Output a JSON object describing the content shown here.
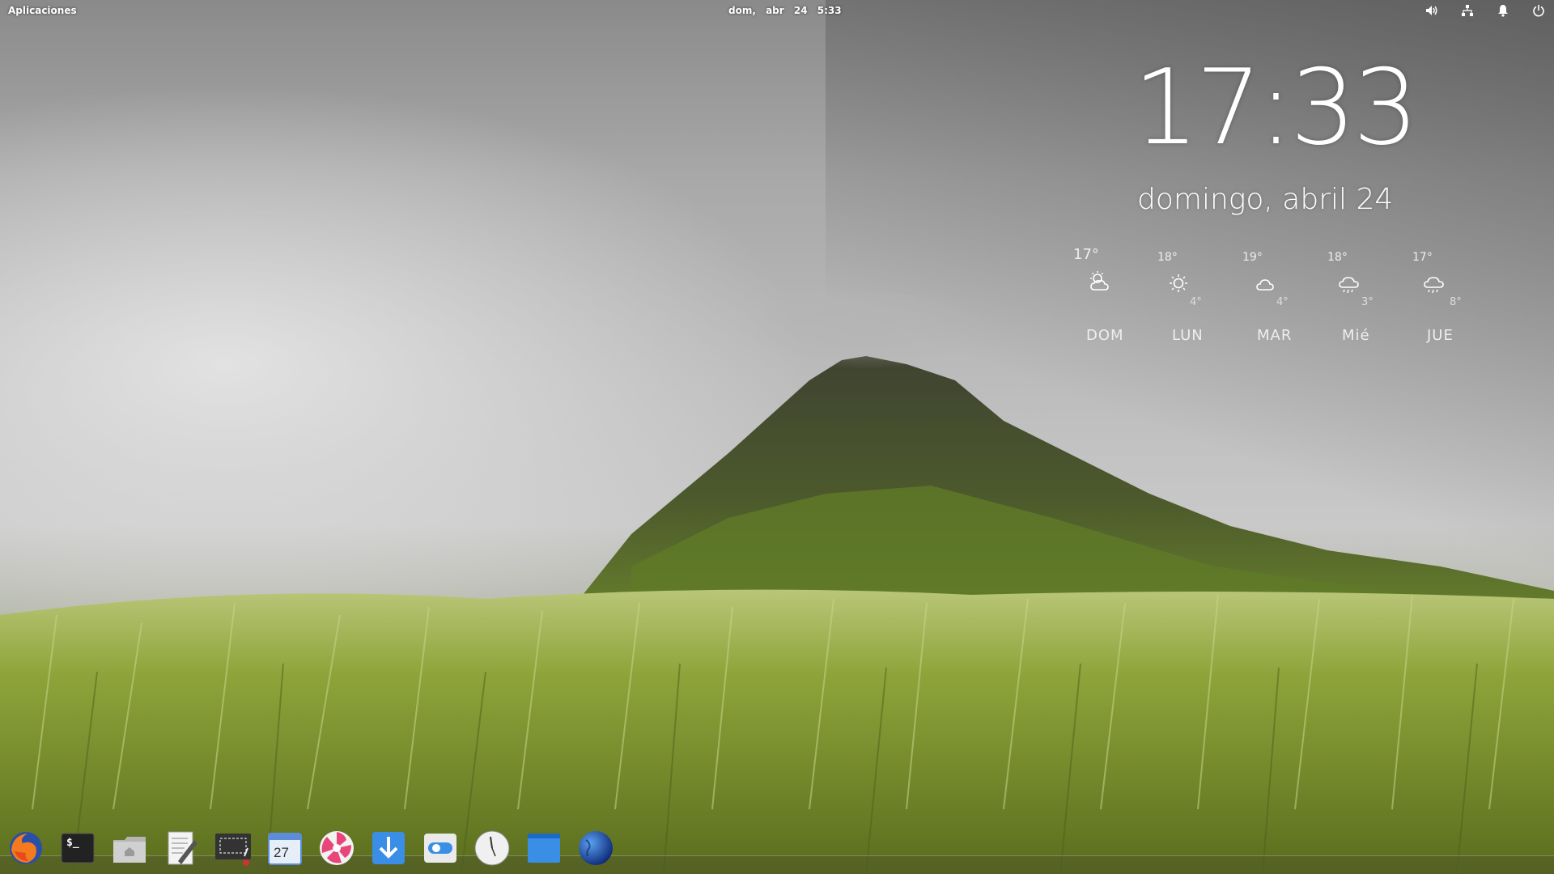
{
  "panel": {
    "apps_label": "Aplicaciones",
    "date": "dom, abr 24",
    "time": "5:33",
    "indicators": [
      "volume-icon",
      "network-icon",
      "notifications-icon",
      "power-icon"
    ]
  },
  "clock_widget": {
    "time": "17:33",
    "date": "domingo, abril 24"
  },
  "forecast": [
    {
      "day": "DOM",
      "high": "17°",
      "low": "",
      "icon": "partly-cloudy-icon"
    },
    {
      "day": "LUN",
      "high": "18°",
      "low": "4°",
      "icon": "sun-icon"
    },
    {
      "day": "MAR",
      "high": "19°",
      "low": "4°",
      "icon": "cloud-icon"
    },
    {
      "day": "Mié",
      "high": "18°",
      "low": "3°",
      "icon": "rain-icon"
    },
    {
      "day": "JUE",
      "high": "17°",
      "low": "8°",
      "icon": "rain-icon"
    }
  ],
  "dock": {
    "items": [
      {
        "name": "firefox",
        "icon": "firefox-icon"
      },
      {
        "name": "terminal",
        "icon": "terminal-icon",
        "label": "$_"
      },
      {
        "name": "files",
        "icon": "home-folder-icon"
      },
      {
        "name": "text-editor",
        "icon": "text-editor-icon"
      },
      {
        "name": "screenshot",
        "icon": "screenshot-icon"
      },
      {
        "name": "calendar",
        "icon": "calendar-icon",
        "label": "27"
      },
      {
        "name": "music",
        "icon": "music-icon"
      },
      {
        "name": "software-center",
        "icon": "download-icon"
      },
      {
        "name": "settings",
        "icon": "toggle-icon"
      },
      {
        "name": "clock",
        "icon": "clock-icon"
      },
      {
        "name": "multitasking",
        "icon": "window-icon"
      },
      {
        "name": "web-browser",
        "icon": "globe-icon"
      }
    ]
  },
  "colors": {
    "panel_text": "#ffffff",
    "dock_shelf": "#5a6428"
  }
}
